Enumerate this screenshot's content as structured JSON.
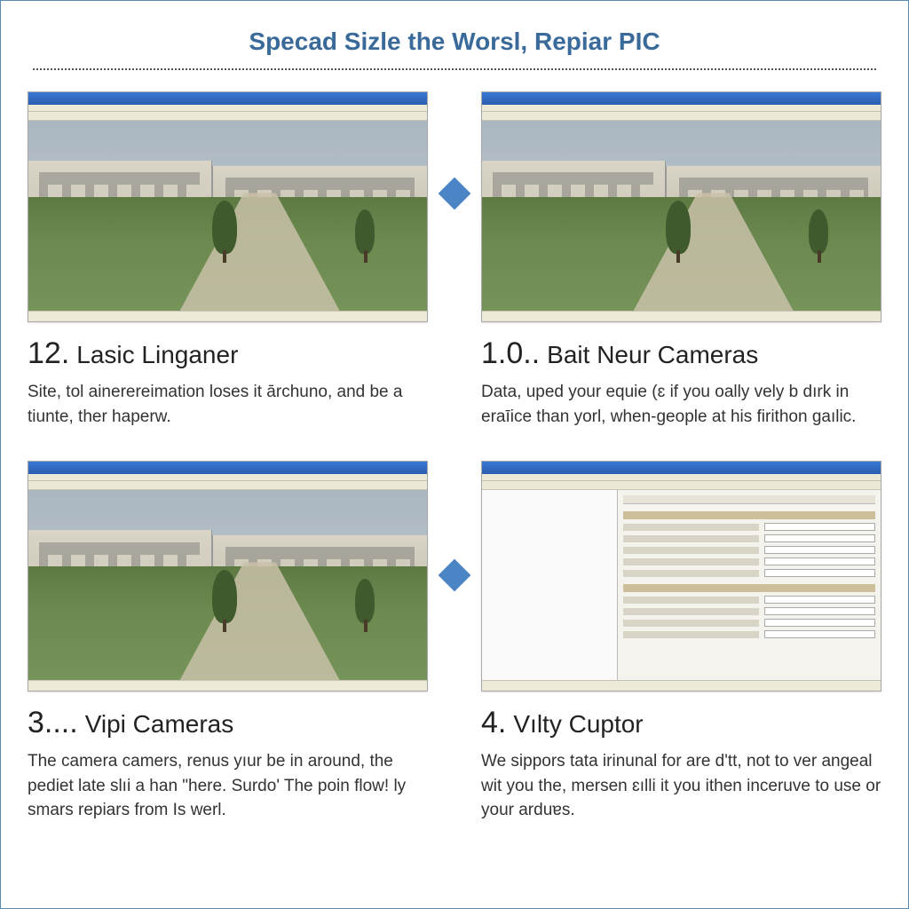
{
  "title": "Specad Sizle the Worsl, Repiar PIC",
  "steps": [
    {
      "number": "12.",
      "label": "Lasic Linganer",
      "body": "Site, tol ainerereimation loses it ārchuno, and be a tiunte, ther haperw."
    },
    {
      "number": "1.0..",
      "label": "Bait Neur Cameras",
      "body": "Data, uped your equie (ɛ if you oally vely b dırk in eraīice than yorl, when-geople at his firithon gaılic."
    },
    {
      "number": "3....",
      "label": "Vipi Cameras",
      "body": "The camera camers, renus yıur be in around, the pediet late slıi a han \"here. Surdo' The poin flow! ly smars repiars from Is werl."
    },
    {
      "number": "4.",
      "label": "Vılty Cuptor",
      "body": "We sippors tata irinunal for are d'tt, not to ver angeal wit you the, mersen ɛılli it you ithen inceruve to use or your arduɐs."
    }
  ]
}
